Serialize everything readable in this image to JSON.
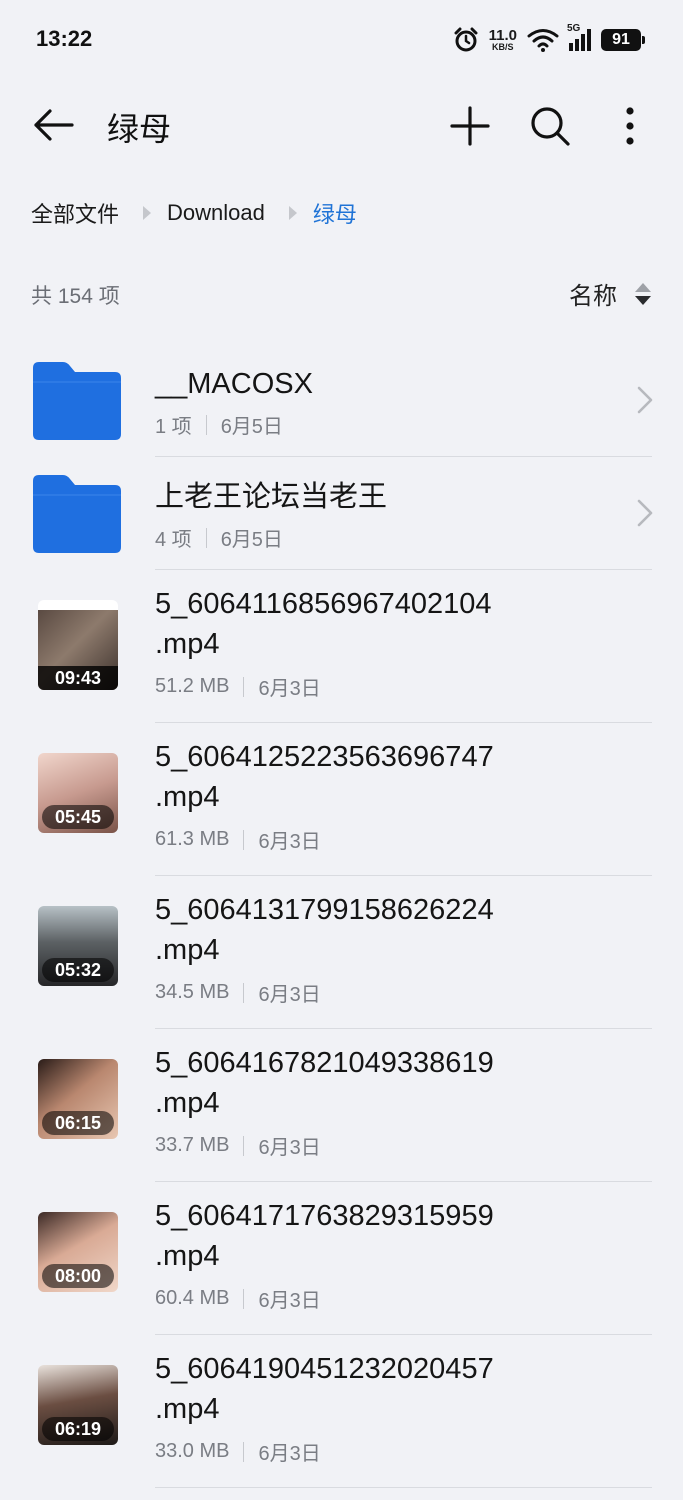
{
  "status_bar": {
    "time": "13:22",
    "net_speed_value": "11.0",
    "net_speed_unit": "KB/S",
    "network_type": "5G",
    "battery": "91"
  },
  "app_bar": {
    "title": "绿母",
    "icons": [
      "back-arrow-icon",
      "plus-icon",
      "search-icon",
      "more-vertical-icon"
    ]
  },
  "breadcrumb": [
    "全部文件",
    "Download",
    "绿母"
  ],
  "summary": {
    "count": "共 154 项",
    "sort_label": "名称"
  },
  "colors": {
    "accent": "#1f73d6",
    "folder": "#1f6fe0",
    "background": "#f1f2f6"
  },
  "files": [
    {
      "type": "folder",
      "name": "__MACOSX",
      "detail": "1 项",
      "date": "6月5日"
    },
    {
      "type": "folder",
      "name": "上老王论坛当老王",
      "detail": "4 项",
      "date": "6月5日"
    },
    {
      "type": "video",
      "name": "5_6064116856967402104.mp4",
      "name_line1": "5_6064116856967402104",
      "name_line2": ".mp4",
      "detail": "51.2 MB",
      "date": "6月3日",
      "duration": "09:43"
    },
    {
      "type": "video",
      "name": "5_6064125223563696747.mp4",
      "name_line1": "5_6064125223563696747",
      "name_line2": ".mp4",
      "detail": "61.3 MB",
      "date": "6月3日",
      "duration": "05:45"
    },
    {
      "type": "video",
      "name": "5_6064131799158626224.mp4",
      "name_line1": "5_6064131799158626224",
      "name_line2": ".mp4",
      "detail": "34.5 MB",
      "date": "6月3日",
      "duration": "05:32"
    },
    {
      "type": "video",
      "name": "5_6064167821049338619.mp4",
      "name_line1": "5_6064167821049338619",
      "name_line2": ".mp4",
      "detail": "33.7 MB",
      "date": "6月3日",
      "duration": "06:15"
    },
    {
      "type": "video",
      "name": "5_6064171763829315959.mp4",
      "name_line1": "5_6064171763829315959",
      "name_line2": ".mp4",
      "detail": "60.4 MB",
      "date": "6月3日",
      "duration": "08:00"
    },
    {
      "type": "video",
      "name": "5_6064190451232020457.mp4",
      "name_line1": "5_6064190451232020457",
      "name_line2": ".mp4",
      "detail": "33.0 MB",
      "date": "6月3日",
      "duration": "06:19"
    }
  ]
}
